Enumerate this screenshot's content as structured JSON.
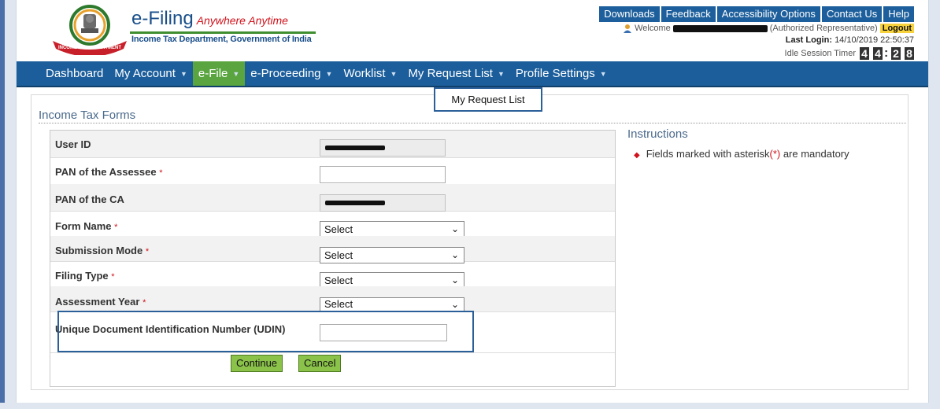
{
  "header": {
    "brand_title": "e-Filing",
    "brand_tagline": "Anywhere Anytime",
    "brand_subtitle": "Income Tax Department, Government of India",
    "emblem_text": "INCOME TAX DEPARTMENT",
    "top_links": [
      "Downloads",
      "Feedback",
      "Accessibility Options",
      "Contact Us",
      "Help"
    ],
    "welcome_label": "Welcome",
    "role_text": "(Authorized Representative)",
    "logout_label": "Logout",
    "last_login_label": "Last Login:",
    "last_login_value": "14/10/2019 22:50:37",
    "idle_timer_label": "Idle Session Timer",
    "idle_timer_digits": [
      "4",
      "4",
      "2",
      "8"
    ]
  },
  "nav": {
    "items": [
      "Dashboard",
      "My Account",
      "e-File",
      "e-Proceeding",
      "Worklist",
      "My Request List",
      "Profile Settings"
    ],
    "active": "e-File",
    "dropdown_item": "My Request List"
  },
  "form": {
    "section_title": "Income Tax Forms",
    "rows": [
      {
        "label": "User ID",
        "required": false,
        "type": "readonly"
      },
      {
        "label": "PAN of the Assessee",
        "required": true,
        "type": "text",
        "value": ""
      },
      {
        "label": "PAN of the CA",
        "required": false,
        "type": "readonly"
      },
      {
        "label": "Form Name",
        "required": true,
        "type": "select",
        "value": "Select"
      },
      {
        "label": "Submission Mode",
        "required": true,
        "type": "select",
        "value": "Select"
      },
      {
        "label": "Filing Type",
        "required": true,
        "type": "select",
        "value": "Select"
      },
      {
        "label": "Assessment Year",
        "required": true,
        "type": "select",
        "value": "Select"
      },
      {
        "label": "Unique Document Identification Number (UDIN)",
        "required": false,
        "type": "text",
        "value": ""
      }
    ],
    "required_marker": "*",
    "continue_label": "Continue",
    "cancel_label": "Cancel"
  },
  "instructions": {
    "title": "Instructions",
    "item_prefix": "Fields marked with asterisk",
    "item_marker": "(*)",
    "item_suffix": " are mandatory"
  },
  "colors": {
    "nav_bg": "#1b5e9b",
    "active_tab": "#5aa53f",
    "button_green": "#8bc34a",
    "brand_blue": "#1a4f8a",
    "brand_red": "#d0121b",
    "highlight_border": "#2b5f98"
  }
}
